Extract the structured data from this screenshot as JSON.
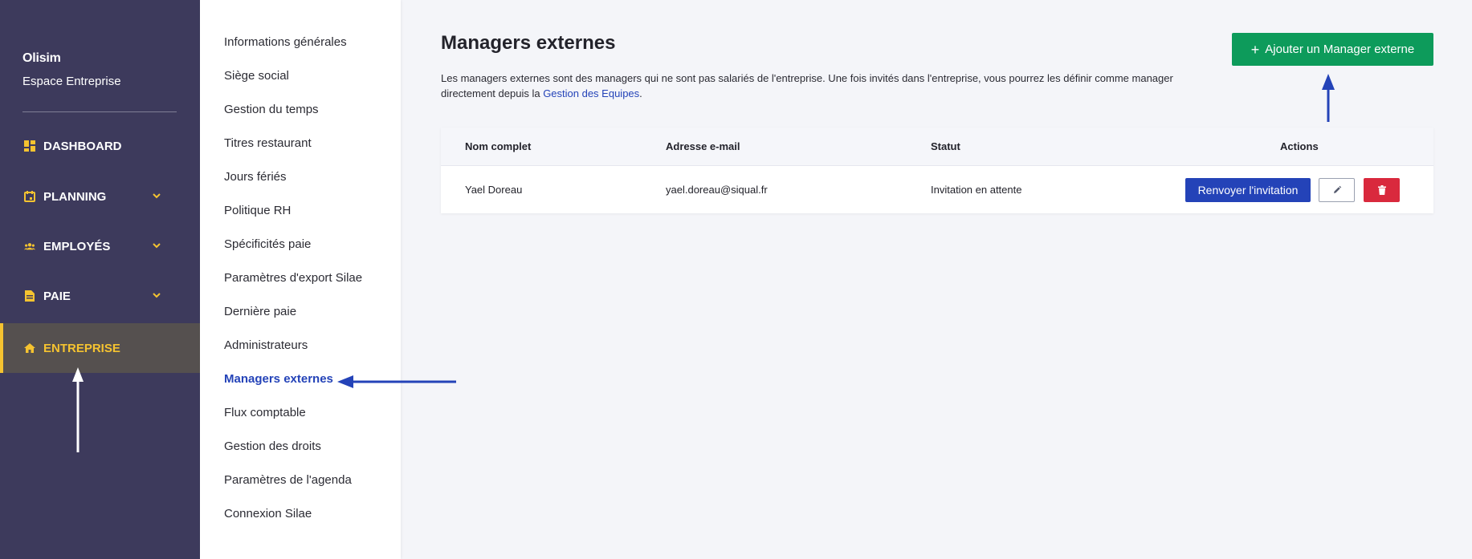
{
  "sidebar": {
    "brand_name": "Olisim",
    "brand_sub": "Espace Entreprise",
    "items": [
      {
        "label": "DASHBOARD",
        "icon": "dashboard-icon"
      },
      {
        "label": "PLANNING",
        "icon": "calendar-icon",
        "expandable": true
      },
      {
        "label": "EMPLOYÉS",
        "icon": "people-icon",
        "expandable": true
      },
      {
        "label": "PAIE",
        "icon": "document-icon",
        "expandable": true
      },
      {
        "label": "ENTREPRISE",
        "icon": "home-icon",
        "active": true
      }
    ]
  },
  "submenu": {
    "items": [
      "Informations générales",
      "Siège social",
      "Gestion du temps",
      "Titres restaurant",
      "Jours fériés",
      "Politique RH",
      "Spécificités paie",
      "Paramètres d'export Silae",
      "Dernière paie",
      "Administrateurs",
      "Managers externes",
      "Flux comptable",
      "Gestion des droits",
      "Paramètres de l'agenda",
      "Connexion Silae"
    ],
    "active_index": 10
  },
  "main": {
    "title": "Managers externes",
    "description_before_link": "Les managers externes sont des managers qui ne sont pas salariés de l'entreprise. Une fois invités dans l'entreprise, vous pourrez les définir comme manager directement depuis la ",
    "description_link": "Gestion des Equipes",
    "description_after_link": ".",
    "add_button_label": "Ajouter un Manager externe",
    "table": {
      "columns": [
        "Nom complet",
        "Adresse e-mail",
        "Statut",
        "Actions"
      ],
      "rows": [
        {
          "name": "Yael Doreau",
          "email": "yael.doreau@siqual.fr",
          "status": "Invitation en attente",
          "resend_label": "Renvoyer l'invitation"
        }
      ]
    }
  },
  "colors": {
    "sidebar_bg": "#3d3a5c",
    "accent_yellow": "#f5c330",
    "primary_blue": "#2443b8",
    "success_green": "#0d9b5b",
    "danger_red": "#d9293d"
  }
}
